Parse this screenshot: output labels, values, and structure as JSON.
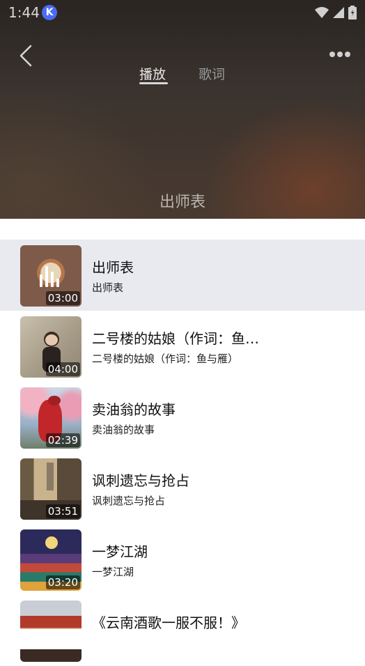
{
  "status": {
    "time": "1:44",
    "app_icon": "K"
  },
  "header": {
    "tabs": [
      {
        "label": "播放",
        "active": true
      },
      {
        "label": "歌词",
        "active": false
      }
    ],
    "now_title": "出师表"
  },
  "playlist": [
    {
      "title": "出师表",
      "subtitle": "出师表",
      "duration": "03:00",
      "selected": true,
      "icon": "playing-bars-icon"
    },
    {
      "title": "二号楼的姑娘（作词：鱼…",
      "subtitle": "二号楼的姑娘（作词：鱼与雁）",
      "duration": "04:00",
      "selected": false
    },
    {
      "title": "卖油翁的故事",
      "subtitle": "卖油翁的故事",
      "duration": "02:39",
      "selected": false
    },
    {
      "title": "讽刺遗忘与抢占",
      "subtitle": "讽刺遗忘与抢占",
      "duration": "03:51",
      "selected": false
    },
    {
      "title": "一梦江湖",
      "subtitle": "一梦江湖",
      "duration": "03:20",
      "selected": false
    },
    {
      "title": "《云南酒歌一服不服！》",
      "subtitle": "",
      "duration": "",
      "selected": false
    }
  ],
  "colors": {
    "selected_row": "#e9e9f0",
    "accent_badge": "#4a6cf7"
  }
}
